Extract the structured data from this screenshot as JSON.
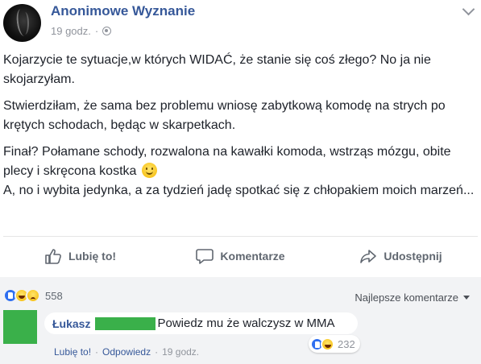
{
  "post": {
    "author": "Anonimowe Wyznanie",
    "time": "19 godz.",
    "dot": "·",
    "paragraphs": [
      "Kojarzycie te sytuacje,w których WIDAĆ, że stanie się coś złego? No ja nie skojarzyłam.",
      "Stwierdziłam, że sama bez problemu wniosę zabytkową komodę na strych po krętych schodach, będąc w skarpetkach.",
      "Finał? Połamane schody, rozwalona na kawałki komoda, wstrząs mózgu, obite plecy i skręcona kostka",
      "A, no i wybita jedynka, a za tydzień jadę spotkać się z chłopakiem moich marzeń..."
    ]
  },
  "actions": {
    "like": "Lubię to!",
    "comment": "Komentarze",
    "share": "Udostępnij"
  },
  "reactions": {
    "icons": [
      "like-icon",
      "haha-icon",
      "sad-icon"
    ],
    "count": "558"
  },
  "sort": {
    "label": "Najlepsze komentarze"
  },
  "comment": {
    "author": "Łukasz",
    "text": "Powiedz mu że walczysz w MMA",
    "reaction_count": "232",
    "like_label": "Lubię to!",
    "reply_label": "Odpowiedz",
    "time": "19 godz.",
    "sep": "·"
  },
  "colors": {
    "link": "#365899",
    "redaction": "#3ab04a",
    "muted": "#90949c"
  }
}
